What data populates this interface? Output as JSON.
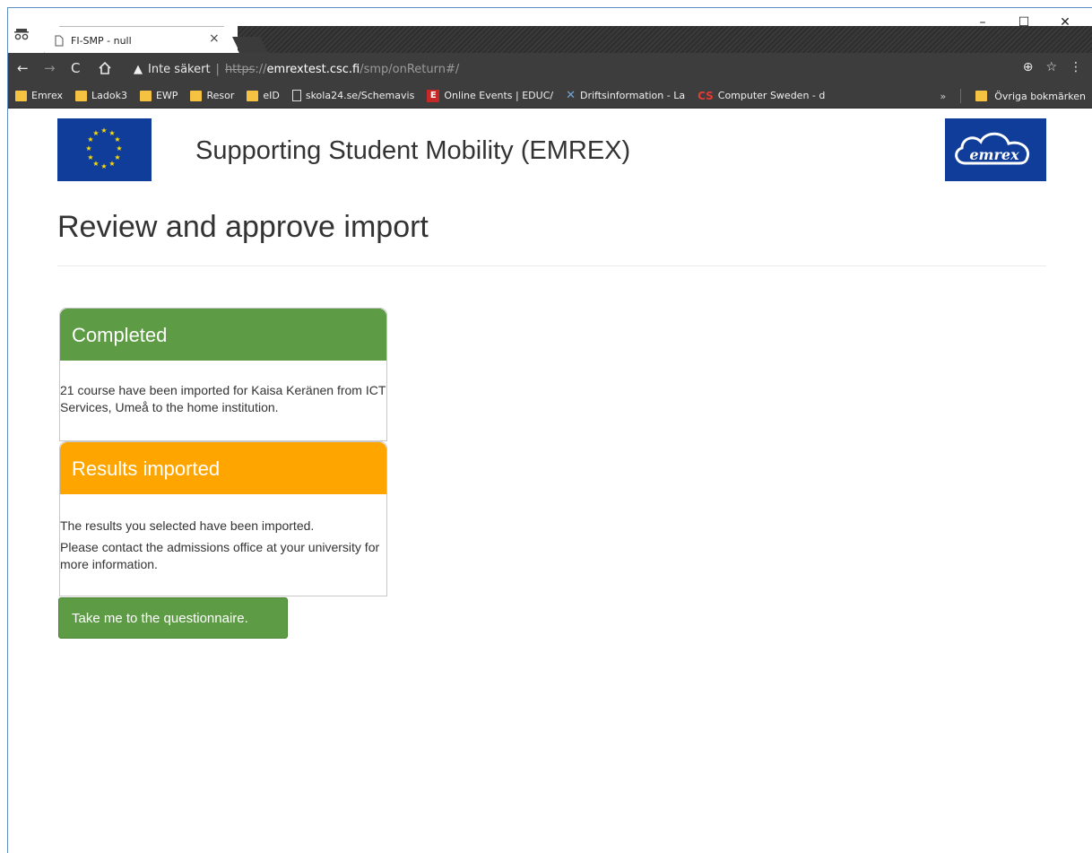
{
  "browser": {
    "tab_title": "FI-SMP - null",
    "tab_close": "×",
    "security_label": "Inte säkert",
    "url_scheme": "https",
    "url_sep": "://",
    "url_host": "emrextest.csc.fi",
    "url_path": "/smp/onReturn#/",
    "window_controls": {
      "minimize": "–",
      "maximize": "☐",
      "close": "✕"
    }
  },
  "bookmarks": {
    "items": [
      {
        "label": "Emrex",
        "icon": "folder-icon"
      },
      {
        "label": "Ladok3",
        "icon": "folder-icon"
      },
      {
        "label": "EWP",
        "icon": "folder-icon"
      },
      {
        "label": "Resor",
        "icon": "folder-icon"
      },
      {
        "label": "eID",
        "icon": "folder-icon"
      },
      {
        "label": "skola24.se/Schemavis",
        "icon": "page-icon"
      },
      {
        "label": "Online Events | EDUC/",
        "icon": "e-icon"
      },
      {
        "label": "Driftsinformation - La",
        "icon": "x-icon"
      },
      {
        "label": "Computer Sweden - d",
        "icon": "cs-icon"
      }
    ],
    "overflow": "»",
    "other_bookmarks": "Övriga bokmärken"
  },
  "page": {
    "site_title": "Supporting Student Mobility (EMREX)",
    "heading": "Review and approve import",
    "completed_panel": {
      "title": "Completed",
      "body": "21 course have been imported for Kaisa Keränen from ICT Services, Umeå to the home institution."
    },
    "results_panel": {
      "title": "Results imported",
      "line1": "The results you selected have been imported.",
      "line2": "Please contact the admissions office at your university for more information."
    },
    "questionnaire_button": "Take me to the questionnaire.",
    "logo_text": "emrex"
  },
  "colors": {
    "completed": "#5d9c45",
    "results": "#ffa500",
    "eu_blue": "#0f3d99"
  }
}
